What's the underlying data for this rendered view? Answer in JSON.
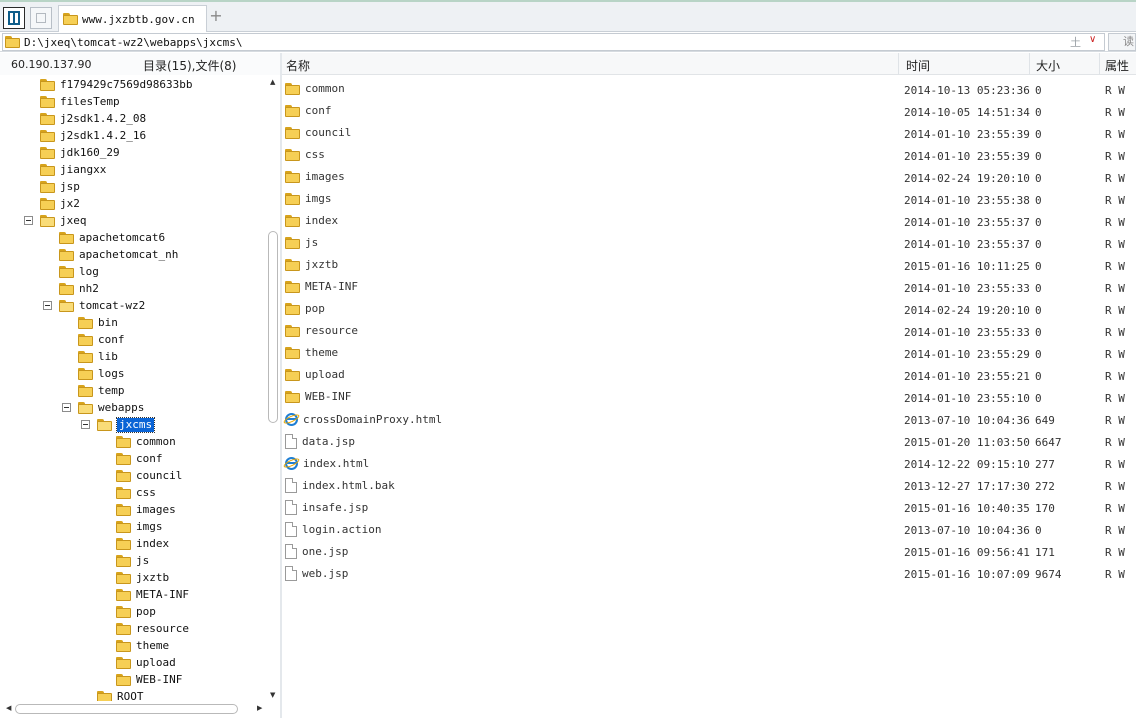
{
  "tabs": {
    "active": "www.jxzbtb.gov.cn",
    "new_tab": "+"
  },
  "address": {
    "path": "D:\\jxeq\\tomcat-wz2\\webapps\\jxcms\\",
    "upload_glyph": "土",
    "dropdown_glyph": "∨",
    "read_label": "读"
  },
  "info": {
    "ip": "60.190.137.90",
    "counts": "目录(15),文件(8)"
  },
  "tree": {
    "items": [
      {
        "label": "f179429c7569d98633bb",
        "depth": 1,
        "expander": false
      },
      {
        "label": "filesTemp",
        "depth": 1,
        "expander": false
      },
      {
        "label": "j2sdk1.4.2_08",
        "depth": 1,
        "expander": false
      },
      {
        "label": "j2sdk1.4.2_16",
        "depth": 1,
        "expander": false
      },
      {
        "label": "jdk160_29",
        "depth": 1,
        "expander": false
      },
      {
        "label": "jiangxx",
        "depth": 1,
        "expander": false
      },
      {
        "label": "jsp",
        "depth": 1,
        "expander": false
      },
      {
        "label": "jx2",
        "depth": 1,
        "expander": false
      },
      {
        "label": "jxeq",
        "depth": 1,
        "expander": true
      },
      {
        "label": "apachetomcat6",
        "depth": 2,
        "expander": false
      },
      {
        "label": "apachetomcat_nh",
        "depth": 2,
        "expander": false
      },
      {
        "label": "log",
        "depth": 2,
        "expander": false
      },
      {
        "label": "nh2",
        "depth": 2,
        "expander": false
      },
      {
        "label": "tomcat-wz2",
        "depth": 2,
        "expander": true
      },
      {
        "label": "bin",
        "depth": 3,
        "expander": false
      },
      {
        "label": "conf",
        "depth": 3,
        "expander": false
      },
      {
        "label": "lib",
        "depth": 3,
        "expander": false
      },
      {
        "label": "logs",
        "depth": 3,
        "expander": false
      },
      {
        "label": "temp",
        "depth": 3,
        "expander": false
      },
      {
        "label": "webapps",
        "depth": 3,
        "expander": true
      },
      {
        "label": "jxcms",
        "depth": 4,
        "expander": true,
        "selected": true
      },
      {
        "label": "common",
        "depth": 5,
        "expander": false
      },
      {
        "label": "conf",
        "depth": 5,
        "expander": false
      },
      {
        "label": "council",
        "depth": 5,
        "expander": false
      },
      {
        "label": "css",
        "depth": 5,
        "expander": false
      },
      {
        "label": "images",
        "depth": 5,
        "expander": false
      },
      {
        "label": "imgs",
        "depth": 5,
        "expander": false
      },
      {
        "label": "index",
        "depth": 5,
        "expander": false
      },
      {
        "label": "js",
        "depth": 5,
        "expander": false
      },
      {
        "label": "jxztb",
        "depth": 5,
        "expander": false
      },
      {
        "label": "META-INF",
        "depth": 5,
        "expander": false
      },
      {
        "label": "pop",
        "depth": 5,
        "expander": false
      },
      {
        "label": "resource",
        "depth": 5,
        "expander": false
      },
      {
        "label": "theme",
        "depth": 5,
        "expander": false
      },
      {
        "label": "upload",
        "depth": 5,
        "expander": false
      },
      {
        "label": "WEB-INF",
        "depth": 5,
        "expander": false
      },
      {
        "label": "ROOT",
        "depth": 4,
        "expander": false
      }
    ]
  },
  "list": {
    "columns": {
      "name": "名称",
      "time": "时间",
      "size": "大小",
      "attr": "属性"
    },
    "rows": [
      {
        "type": "folder",
        "name": "common",
        "time": "2014-10-13 05:23:36",
        "size": "0",
        "attr": "R W"
      },
      {
        "type": "folder",
        "name": "conf",
        "time": "2014-10-05 14:51:34",
        "size": "0",
        "attr": "R W"
      },
      {
        "type": "folder",
        "name": "council",
        "time": "2014-01-10 23:55:39",
        "size": "0",
        "attr": "R W"
      },
      {
        "type": "folder",
        "name": "css",
        "time": "2014-01-10 23:55:39",
        "size": "0",
        "attr": "R W"
      },
      {
        "type": "folder",
        "name": "images",
        "time": "2014-02-24 19:20:10",
        "size": "0",
        "attr": "R W"
      },
      {
        "type": "folder",
        "name": "imgs",
        "time": "2014-01-10 23:55:38",
        "size": "0",
        "attr": "R W"
      },
      {
        "type": "folder",
        "name": "index",
        "time": "2014-01-10 23:55:37",
        "size": "0",
        "attr": "R W"
      },
      {
        "type": "folder",
        "name": "js",
        "time": "2014-01-10 23:55:37",
        "size": "0",
        "attr": "R W"
      },
      {
        "type": "folder",
        "name": "jxztb",
        "time": "2015-01-16 10:11:25",
        "size": "0",
        "attr": "R W"
      },
      {
        "type": "folder",
        "name": "META-INF",
        "time": "2014-01-10 23:55:33",
        "size": "0",
        "attr": "R W"
      },
      {
        "type": "folder",
        "name": "pop",
        "time": "2014-02-24 19:20:10",
        "size": "0",
        "attr": "R W"
      },
      {
        "type": "folder",
        "name": "resource",
        "time": "2014-01-10 23:55:33",
        "size": "0",
        "attr": "R W"
      },
      {
        "type": "folder",
        "name": "theme",
        "time": "2014-01-10 23:55:29",
        "size": "0",
        "attr": "R W"
      },
      {
        "type": "folder",
        "name": "upload",
        "time": "2014-01-10 23:55:21",
        "size": "0",
        "attr": "R W"
      },
      {
        "type": "folder",
        "name": "WEB-INF",
        "time": "2014-01-10 23:55:10",
        "size": "0",
        "attr": "R W"
      },
      {
        "type": "html",
        "name": "crossDomainProxy.html",
        "time": "2013-07-10 10:04:36",
        "size": "649",
        "attr": "R W"
      },
      {
        "type": "file",
        "name": "data.jsp",
        "time": "2015-01-20 11:03:50",
        "size": "6647",
        "attr": "R W"
      },
      {
        "type": "html",
        "name": "index.html",
        "time": "2014-12-22 09:15:10",
        "size": "277",
        "attr": "R W"
      },
      {
        "type": "file",
        "name": "index.html.bak",
        "time": "2013-12-27 17:17:30",
        "size": "272",
        "attr": "R W"
      },
      {
        "type": "file",
        "name": "insafe.jsp",
        "time": "2015-01-16 10:40:35",
        "size": "170",
        "attr": "R W"
      },
      {
        "type": "file",
        "name": "login.action",
        "time": "2013-07-10 10:04:36",
        "size": "0",
        "attr": "R W"
      },
      {
        "type": "file",
        "name": "one.jsp",
        "time": "2015-01-16 09:56:41",
        "size": "171",
        "attr": "R W"
      },
      {
        "type": "file",
        "name": "web.jsp",
        "time": "2015-01-16 10:07:09",
        "size": "9674",
        "attr": "R W"
      }
    ]
  },
  "icons": {
    "folder": "folder-icon",
    "file": "file-icon",
    "html": "ie-html-icon"
  }
}
